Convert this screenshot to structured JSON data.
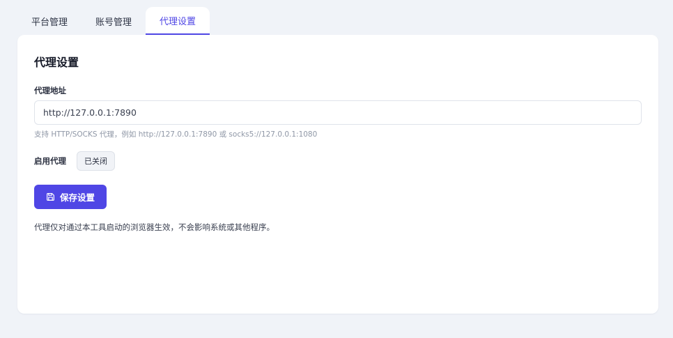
{
  "tabs": [
    {
      "label": "平台管理",
      "active": false
    },
    {
      "label": "账号管理",
      "active": false
    },
    {
      "label": "代理设置",
      "active": true
    }
  ],
  "panel": {
    "title": "代理设置",
    "proxy_address_label": "代理地址",
    "proxy_address_value": "http://127.0.0.1:7890",
    "proxy_hint": "支持 HTTP/SOCKS 代理，例如 http://127.0.0.1:7890 或 socks5://127.0.0.1:1080",
    "enable_label": "启用代理",
    "enable_state": "已关闭",
    "save_label": "保存设置",
    "save_icon": "floppy-disk-icon",
    "note": "代理仅对通过本工具启动的浏览器生效，不会影响系统或其他程序。"
  },
  "colors": {
    "accent": "#4f46e5",
    "background": "#f0f3f8",
    "card": "#ffffff"
  }
}
